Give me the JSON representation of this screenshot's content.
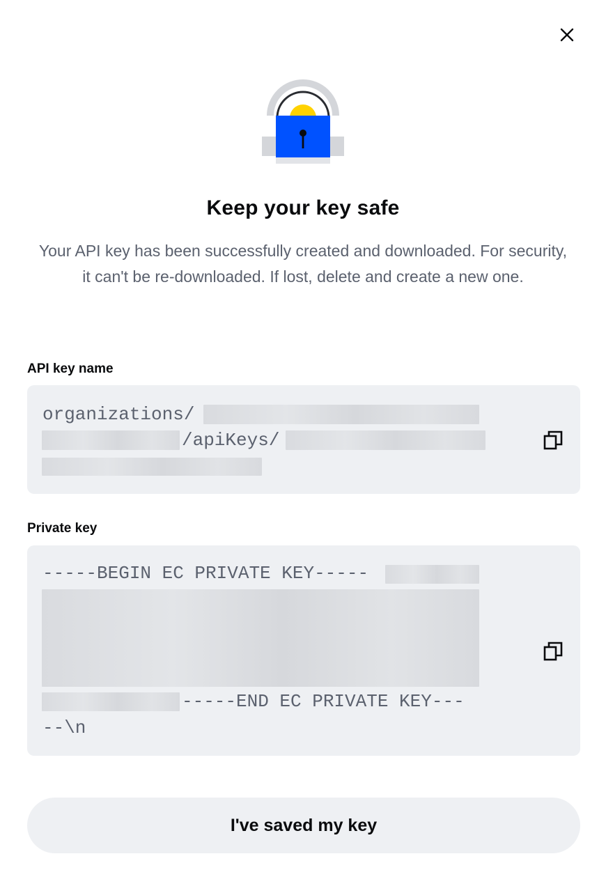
{
  "dialog": {
    "title": "Keep your key safe",
    "description": "Your API key has been successfully created and downloaded. For security, it can't be re-downloaded. If lost, delete and create a new one.",
    "close_icon": "close-icon",
    "illustration": "padlock-illustration"
  },
  "api_key_name": {
    "label": "API key name",
    "value_prefix": "organizations/",
    "value_middle": "/apiKeys/",
    "copy_icon": "copy-icon"
  },
  "private_key": {
    "label": "Private key",
    "begin_line": "-----BEGIN EC PRIVATE KEY-----",
    "end_line": "-----END EC PRIVATE KEY---",
    "end_tail": "--\\n",
    "copy_icon": "copy-icon"
  },
  "actions": {
    "confirm_label": "I've saved my key"
  },
  "colors": {
    "lock_blue": "#0052ff",
    "lock_yellow": "#ffd200",
    "field_bg": "#eef0f3",
    "muted_text": "#5b616e"
  }
}
